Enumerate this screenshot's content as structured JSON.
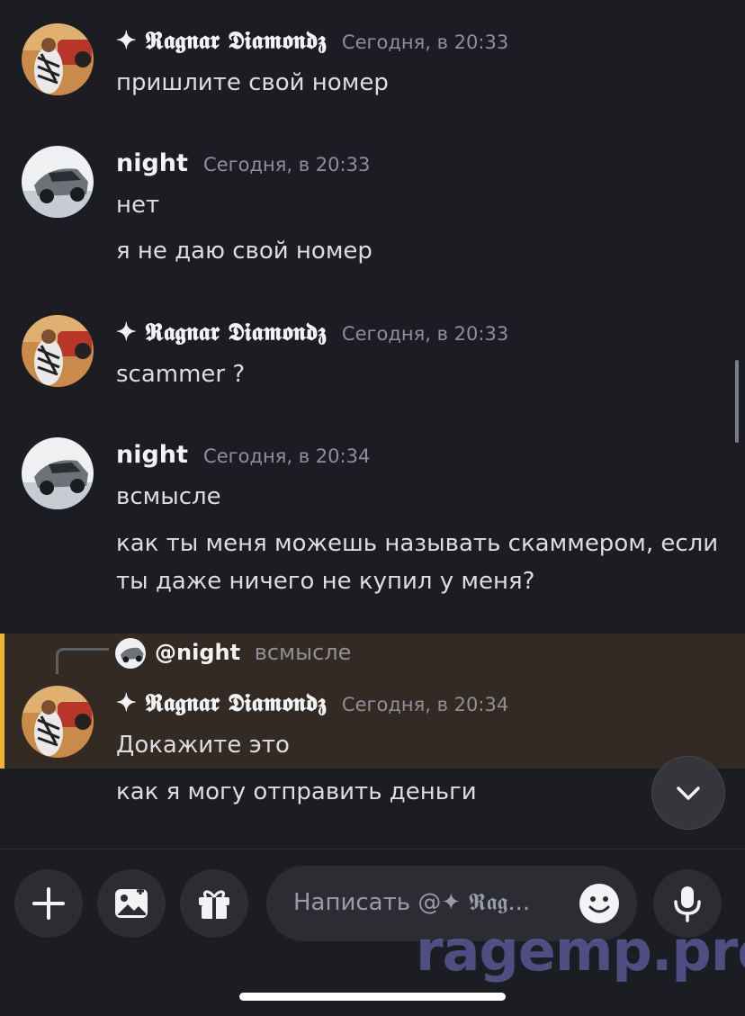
{
  "messages": [
    {
      "author": "✦ 𝕽𝖆𝖌𝖓𝖆𝖗 𝕯𝖎𝖆𝖒𝖔𝖓𝖉𝖟",
      "timestamp": "Сегодня, в 20:33",
      "lines": [
        "пришлите свой номер"
      ]
    },
    {
      "author": "night",
      "timestamp": "Сегодня, в 20:33",
      "lines": [
        "нет",
        "я не даю свой номер"
      ]
    },
    {
      "author": "✦ 𝕽𝖆𝖌𝖓𝖆𝖗 𝕯𝖎𝖆𝖒𝖔𝖓𝖉𝖟",
      "timestamp": "Сегодня, в 20:33",
      "lines": [
        "scammer ?"
      ]
    },
    {
      "author": "night",
      "timestamp": "Сегодня, в 20:34",
      "lines": [
        "всмысле",
        "как ты меня можешь называть скаммером, если",
        "ты даже ничего не купил у меня?"
      ]
    },
    {
      "reply": {
        "mention": "@night",
        "text": "всмысле"
      },
      "author": "✦ 𝕽𝖆𝖌𝖓𝖆𝖗 𝕯𝖎𝖆𝖒𝖔𝖓𝖉𝖟",
      "timestamp": "Сегодня, в 20:34",
      "lines": [
        "Докажите это",
        "как я могу отправить деньги"
      ]
    }
  ],
  "composer": {
    "placeholder": "Написать @✦ 𝕽𝖆𝖌...",
    "buttons": [
      "plus-icon",
      "image-icon",
      "gift-icon",
      "emoji-icon",
      "microphone-icon"
    ]
  },
  "watermark": "ragemp.pro",
  "colors": {
    "background": "#1c1d22",
    "highlight": "#332b23",
    "mention_bar": "#f0b232",
    "timestamp": "#8e9099",
    "watermark": "#706cbe"
  }
}
